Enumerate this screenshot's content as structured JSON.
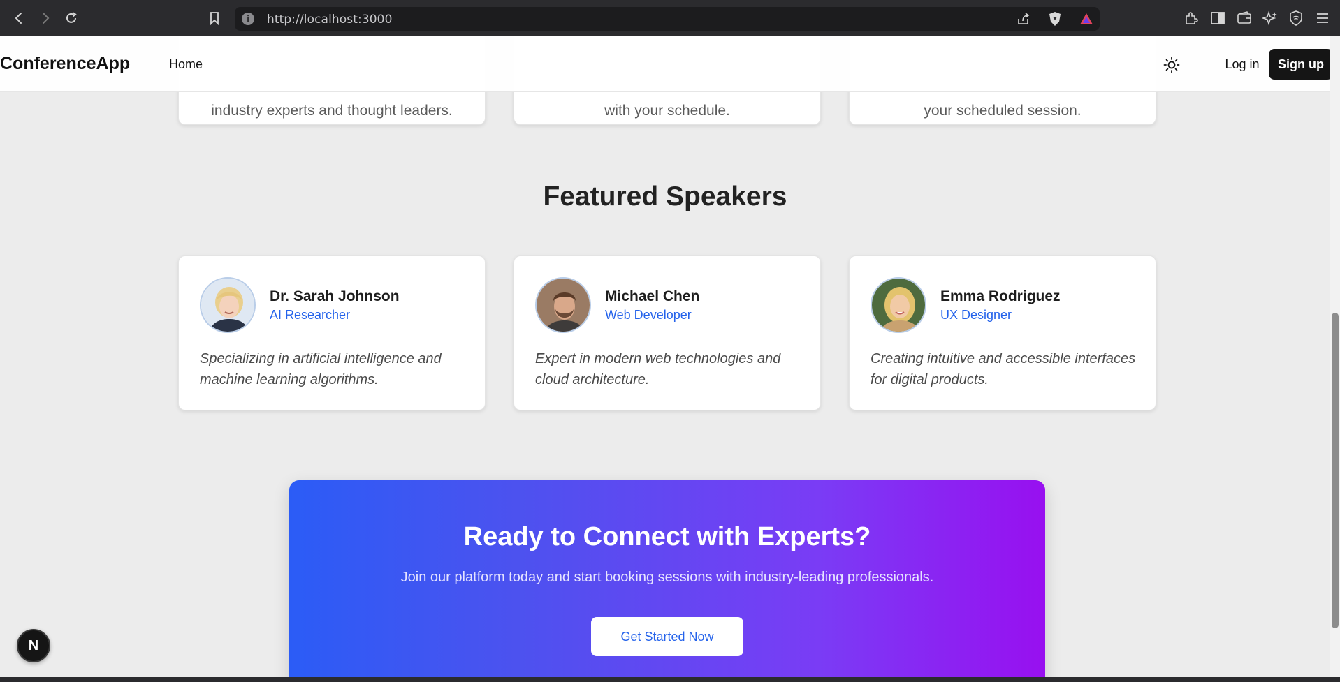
{
  "browser": {
    "url": "http://localhost:3000"
  },
  "header": {
    "brand": "ConferenceApp",
    "nav_home": "Home",
    "login": "Log in",
    "signup": "Sign up"
  },
  "features": [
    {
      "line1": "industry experts and thought leaders."
    },
    {
      "line1": "with your schedule."
    },
    {
      "line1": "your scheduled session."
    }
  ],
  "speakers_section": {
    "title": "Featured Speakers",
    "speakers": [
      {
        "name": "Dr. Sarah Johnson",
        "role": "AI Researcher",
        "bio": "Specializing in artificial intelligence and machine learning algorithms."
      },
      {
        "name": "Michael Chen",
        "role": "Web Developer",
        "bio": "Expert in modern web technologies and cloud architecture."
      },
      {
        "name": "Emma Rodriguez",
        "role": "UX Designer",
        "bio": "Creating intuitive and accessible interfaces for digital products."
      }
    ]
  },
  "cta": {
    "title": "Ready to Connect with Experts?",
    "subtitle": "Join our platform today and start booking sessions with industry-leading professionals.",
    "button": "Get Started Now"
  },
  "dev_badge": "N",
  "colors": {
    "accent": "#2563eb",
    "cta_gradient_start": "#2b5cf6",
    "cta_gradient_end": "#9810f0",
    "signup_bg": "#151515"
  }
}
